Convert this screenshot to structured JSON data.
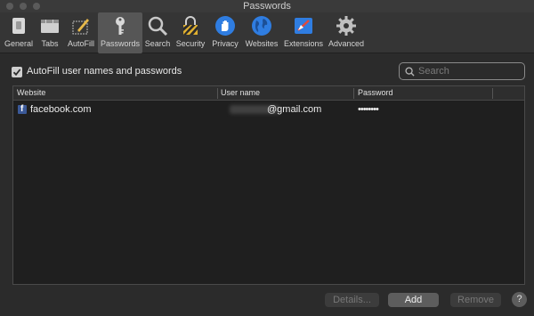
{
  "window": {
    "title": "Passwords"
  },
  "toolbar": {
    "items": [
      {
        "label": "General",
        "icon": "general-icon"
      },
      {
        "label": "Tabs",
        "icon": "tabs-icon"
      },
      {
        "label": "AutoFill",
        "icon": "autofill-icon"
      },
      {
        "label": "Passwords",
        "icon": "key-icon",
        "active": true
      },
      {
        "label": "Search",
        "icon": "magnifier-icon"
      },
      {
        "label": "Security",
        "icon": "lock-icon"
      },
      {
        "label": "Privacy",
        "icon": "hand-icon"
      },
      {
        "label": "Websites",
        "icon": "globe-icon"
      },
      {
        "label": "Extensions",
        "icon": "puzzle-icon"
      },
      {
        "label": "Advanced",
        "icon": "gear-icon"
      }
    ]
  },
  "autofill": {
    "label": "AutoFill user names and passwords",
    "checked": true
  },
  "search": {
    "placeholder": "Search",
    "value": ""
  },
  "table": {
    "columns": [
      "Website",
      "User name",
      "Password"
    ],
    "rows": [
      {
        "website": "facebook.com",
        "username": "@gmail.com",
        "password": "••••••••"
      }
    ]
  },
  "buttons": {
    "details": "Details...",
    "add": "Add",
    "remove": "Remove",
    "help": "?"
  },
  "colors": {
    "accent_blue": "#2f7de1",
    "facebook_blue": "#3b5998"
  }
}
